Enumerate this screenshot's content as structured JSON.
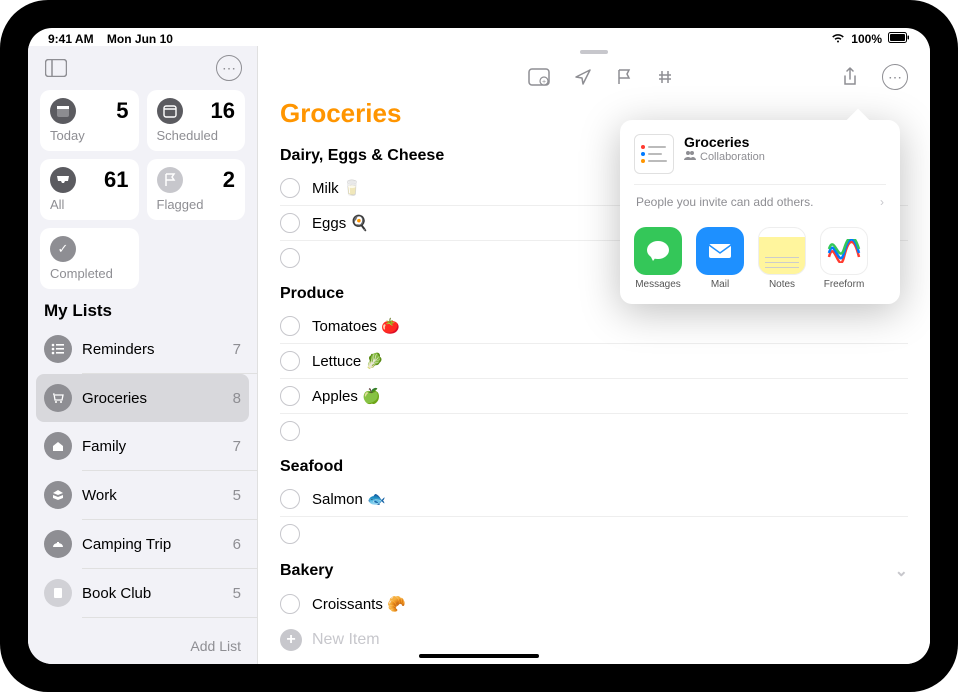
{
  "statusbar": {
    "time": "9:41 AM",
    "date": "Mon Jun 10",
    "battery": "100%"
  },
  "sidebar": {
    "smart": {
      "today": {
        "label": "Today",
        "count": 5
      },
      "scheduled": {
        "label": "Scheduled",
        "count": 16
      },
      "all": {
        "label": "All",
        "count": 61
      },
      "flagged": {
        "label": "Flagged",
        "count": 2
      },
      "completed": {
        "label": "Completed"
      }
    },
    "mylists_header": "My Lists",
    "lists": [
      {
        "name": "Reminders",
        "count": 7,
        "color": "#8e8e93"
      },
      {
        "name": "Groceries",
        "count": 8,
        "color": "#8e8e93",
        "selected": true
      },
      {
        "name": "Family",
        "count": 7,
        "color": "#8e8e93"
      },
      {
        "name": "Work",
        "count": 5,
        "color": "#8e8e93"
      },
      {
        "name": "Camping Trip",
        "count": 6,
        "color": "#8e8e93"
      },
      {
        "name": "Book Club",
        "count": 5,
        "color": "#d1d1d6"
      }
    ],
    "add_list": "Add List"
  },
  "main": {
    "title": "Groceries",
    "sections": [
      {
        "title": "Dairy, Eggs & Cheese",
        "items": [
          "Milk 🥛",
          "Eggs 🍳"
        ],
        "empty": 1
      },
      {
        "title": "Produce",
        "items": [
          "Tomatoes 🍅",
          "Lettuce 🥬",
          "Apples 🍏"
        ],
        "empty": 1
      },
      {
        "title": "Seafood",
        "items": [
          "Salmon 🐟"
        ],
        "empty": 1
      },
      {
        "title": "Bakery",
        "items": [
          "Croissants 🥐"
        ],
        "collapsible": true
      }
    ],
    "new_item": "New Item"
  },
  "share": {
    "title": "Groceries",
    "subtitle": "Collaboration",
    "invite_text": "People you invite can add others.",
    "apps": [
      {
        "label": "Messages",
        "color": "#34c759",
        "glyph": "✉"
      },
      {
        "label": "Mail",
        "color": "#1e90ff",
        "glyph": "✉"
      },
      {
        "label": "Notes",
        "color": "#ffffff",
        "glyph": ""
      },
      {
        "label": "Freeform",
        "color": "#ffffff",
        "glyph": ""
      }
    ]
  }
}
